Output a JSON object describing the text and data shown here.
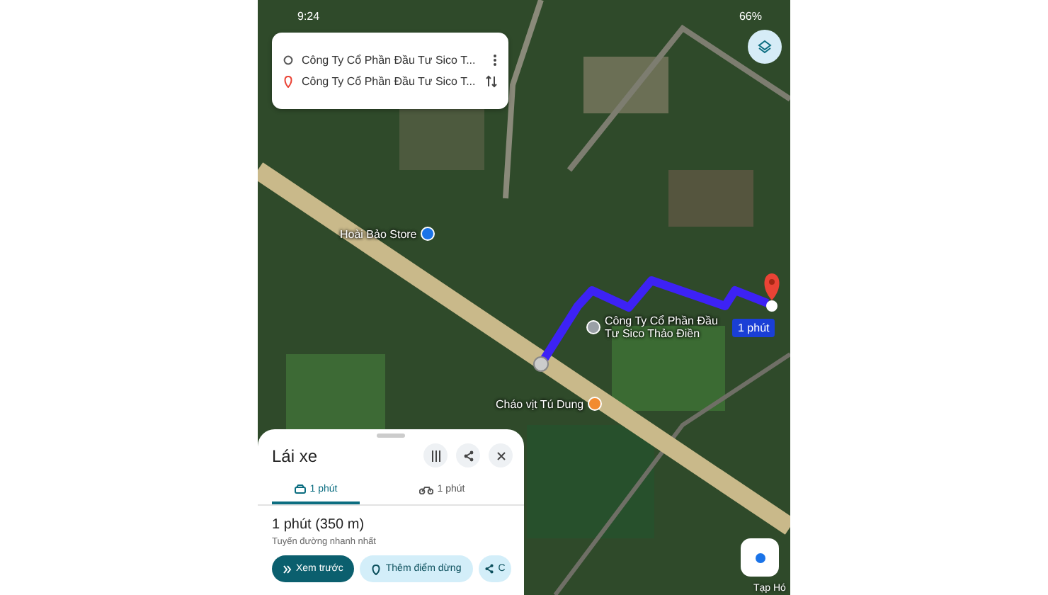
{
  "status_bar": {
    "time": "9:24",
    "battery": "66%"
  },
  "route_card": {
    "origin": "Công Ty Cổ Phần Đầu Tư Sico T...",
    "destination": "Công Ty Cổ Phần Đầu Tư Sico T..."
  },
  "map": {
    "places": [
      {
        "name": "Hoài Bảo Store",
        "kind": "shop"
      },
      {
        "name": "Công Ty Cổ Phần Đầu Tư Sico Thảo Điền",
        "kind": "company"
      },
      {
        "name": "Cháo vịt Tú Dung",
        "kind": "food"
      }
    ],
    "eta_badge": "1 phút",
    "edge_label": "Tạp Hó"
  },
  "sheet": {
    "title": "Lái xe",
    "tabs": [
      {
        "label": "1 phút",
        "kind": "car",
        "selected": true
      },
      {
        "label": "1 phút",
        "kind": "motorbike",
        "selected": false
      }
    ],
    "duration": "1 phút (350 m)",
    "note": "Tuyến đường nhanh nhất",
    "buttons": [
      {
        "label": "Xem trước",
        "kind": "primary"
      },
      {
        "label": "Thêm điểm dừng",
        "kind": "secondary"
      },
      {
        "label": "C",
        "kind": "share"
      }
    ]
  }
}
